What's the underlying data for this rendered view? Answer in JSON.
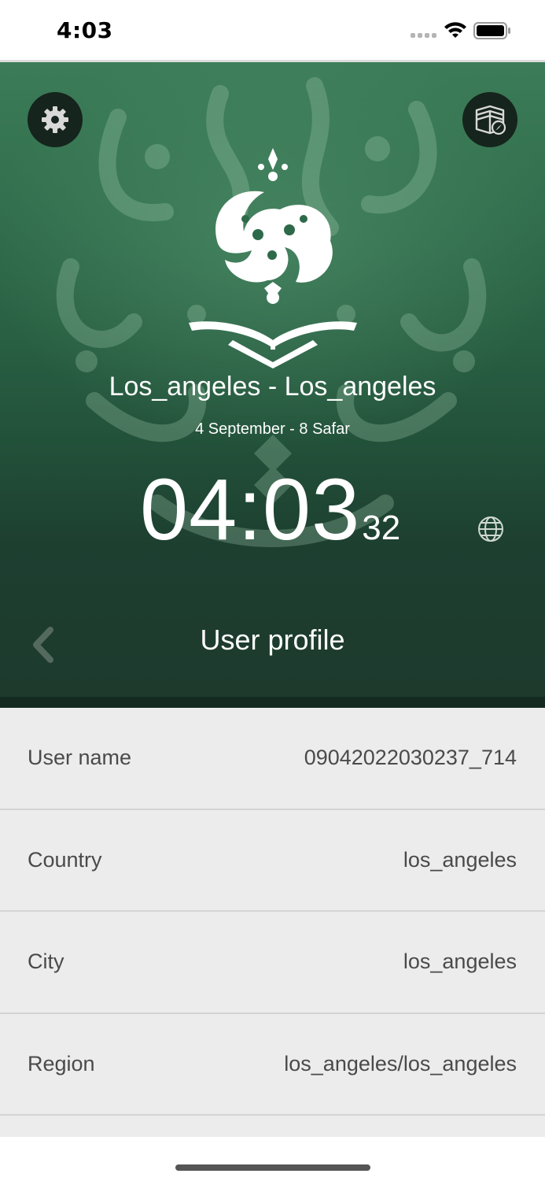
{
  "status_bar": {
    "time": "4:03"
  },
  "header": {
    "location": "Los_angeles - Los_angeles",
    "date": "4 September - 8 Safar",
    "clock": {
      "hours_minutes": "04:03",
      "seconds": "32"
    },
    "page_title": "User profile"
  },
  "icons": {
    "settings": "gear-icon",
    "qibla": "kaaba-compass-icon",
    "globe": "globe-icon",
    "back": "chevron-left-icon"
  },
  "profile": {
    "rows": [
      {
        "label": "User name",
        "value": "09042022030237_714"
      },
      {
        "label": "Country",
        "value": "los_angeles"
      },
      {
        "label": "City",
        "value": "los_angeles"
      },
      {
        "label": "Region",
        "value": "los_angeles/los_angeles"
      }
    ]
  },
  "colors": {
    "hero_top": "#3c7c58",
    "hero_bottom": "#1d3a2d",
    "button_bg": "#15241c",
    "list_bg": "#ececec",
    "text": "#4a4a4a"
  }
}
